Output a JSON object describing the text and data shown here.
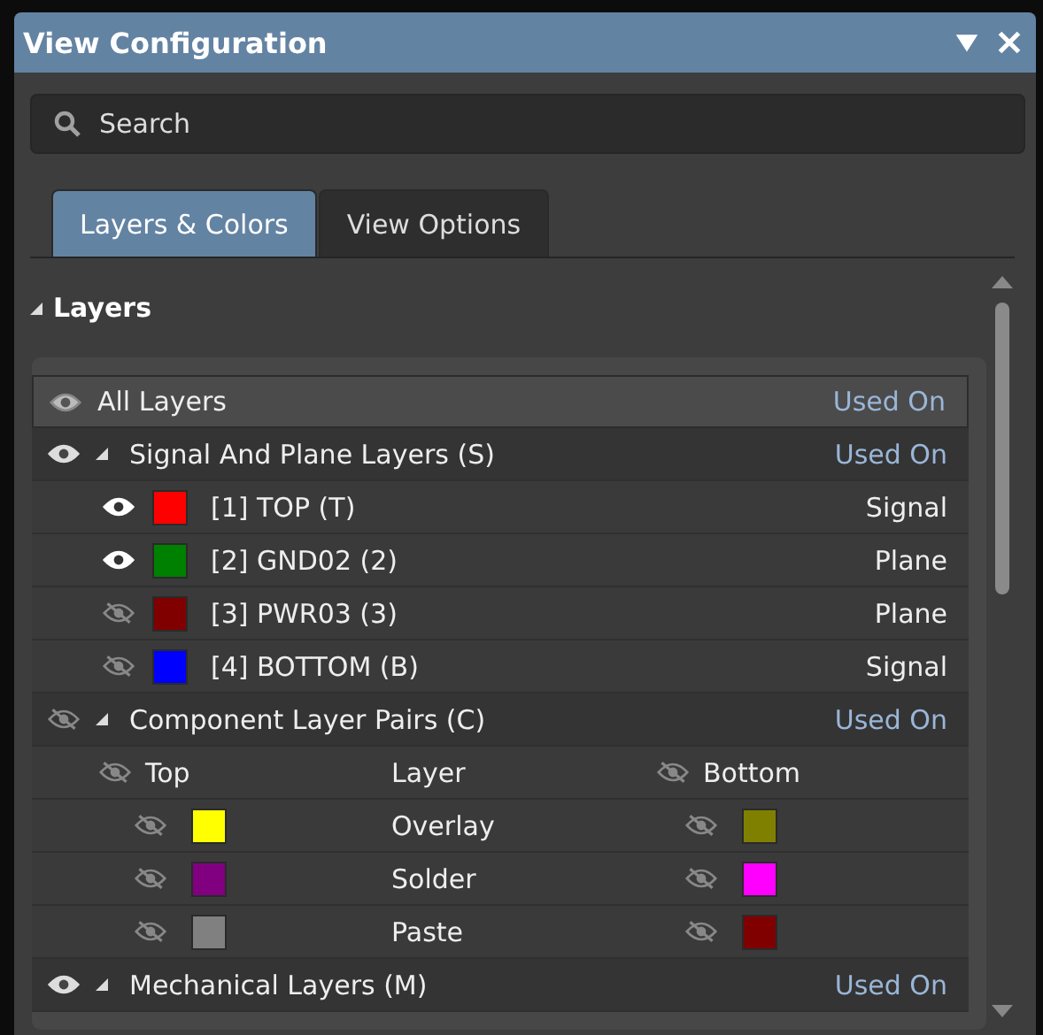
{
  "window": {
    "title": "View Configuration"
  },
  "search": {
    "placeholder": "Search"
  },
  "tabs": [
    {
      "label": "Layers & Colors",
      "selected": true
    },
    {
      "label": "View Options",
      "selected": false
    }
  ],
  "section": {
    "title": "Layers",
    "expanded": true
  },
  "all_layers": {
    "label": "All Layers",
    "used_on": "Used On",
    "visible": true
  },
  "groups": [
    {
      "kind": "signal",
      "label": "Signal And Plane Layers (S)",
      "used_on": "Used On",
      "visible": true,
      "expanded": true,
      "layers": [
        {
          "label": "[1] TOP (T)",
          "color": "#ff0000",
          "visible": true,
          "type": "Signal"
        },
        {
          "label": "[2] GND02 (2)",
          "color": "#008000",
          "visible": true,
          "type": "Plane"
        },
        {
          "label": "[3] PWR03 (3)",
          "color": "#800000",
          "visible": false,
          "type": "Plane"
        },
        {
          "label": "[4] BOTTOM (B)",
          "color": "#0000ff",
          "visible": false,
          "type": "Signal"
        }
      ]
    },
    {
      "kind": "pairs",
      "label": "Component Layer Pairs (C)",
      "used_on": "Used On",
      "visible": false,
      "expanded": true,
      "header": {
        "top": "Top",
        "layer": "Layer",
        "bottom": "Bottom",
        "top_visible": false,
        "bottom_visible": false
      },
      "pairs": [
        {
          "layer": "Overlay",
          "top": {
            "color": "#ffff00",
            "visible": false
          },
          "bottom": {
            "color": "#808000",
            "visible": false
          }
        },
        {
          "layer": "Solder",
          "top": {
            "color": "#800080",
            "visible": false
          },
          "bottom": {
            "color": "#ff00ff",
            "visible": false
          }
        },
        {
          "layer": "Paste",
          "top": {
            "color": "#808080",
            "visible": false
          },
          "bottom": {
            "color": "#800000",
            "visible": false
          }
        }
      ]
    },
    {
      "kind": "mechanical",
      "label": "Mechanical Layers (M)",
      "used_on": "Used On",
      "visible": true,
      "expanded": true
    }
  ]
}
